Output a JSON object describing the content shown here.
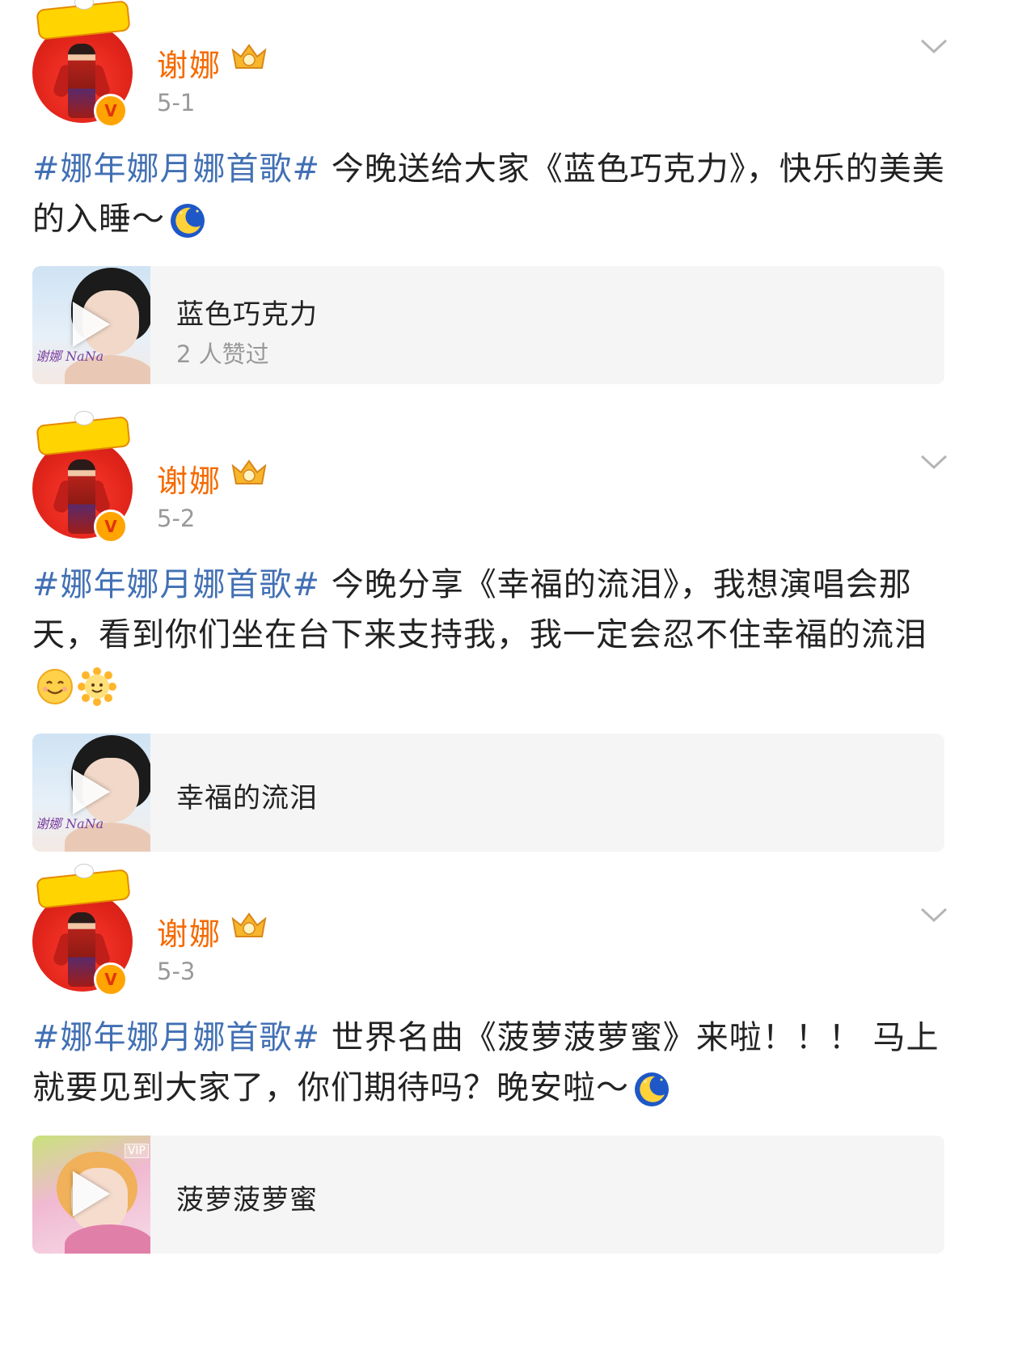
{
  "posts": [
    {
      "user": "谢娜",
      "date": "5-1",
      "topic": "#娜年娜月娜首歌#",
      "text": " 今晚送给大家《蓝色巧克力》，快乐的美美的入睡～",
      "emojis": [
        "moon-emoji"
      ],
      "card": {
        "title": "蓝色巧克力",
        "subtitle": "2 人赞过"
      }
    },
    {
      "user": "谢娜",
      "date": "5-2",
      "topic": "#娜年娜月娜首歌#",
      "text": " 今晚分享《幸福的流泪》，我想演唱会那天，看到你们坐在台下来支持我，我一定会忍不住幸福的流泪",
      "emojis": [
        "smile-emoji",
        "sun-emoji"
      ],
      "card": {
        "title": "幸福的流泪"
      }
    },
    {
      "user": "谢娜",
      "date": "5-3",
      "topic": "#娜年娜月娜首歌#",
      "text": " 世界名曲《菠萝菠萝蜜》来啦！！！ 马上就要见到大家了，你们期待吗？晚安啦～",
      "emojis": [
        "moon-emoji"
      ],
      "card": {
        "title": "菠萝菠萝蜜",
        "badge": "VIP"
      }
    }
  ],
  "colors": {
    "name": "#f56a00",
    "topic": "#4270b4",
    "meta": "#999999",
    "card_bg": "#f5f5f5"
  }
}
